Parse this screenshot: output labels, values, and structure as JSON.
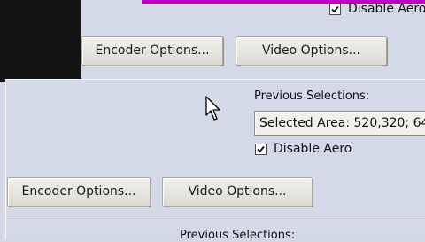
{
  "back_window": {
    "aero_checkbox": {
      "label": "Disable Aero",
      "checked": true
    },
    "encoder_button": "Encoder Options...",
    "video_button": "Video Options...",
    "accent_color": "#c000c0"
  },
  "front_window": {
    "previous_selections_label": "Previous Selections:",
    "selected_area_text": "Selected Area: 520,320; 64",
    "aero_checkbox": {
      "label": "Disable Aero",
      "checked": true
    },
    "encoder_button": "Encoder Options...",
    "video_button": "Video Options...",
    "bottom_label": "Previous Selections:"
  },
  "cursor": {
    "icon": "arrow-cursor-icon"
  }
}
